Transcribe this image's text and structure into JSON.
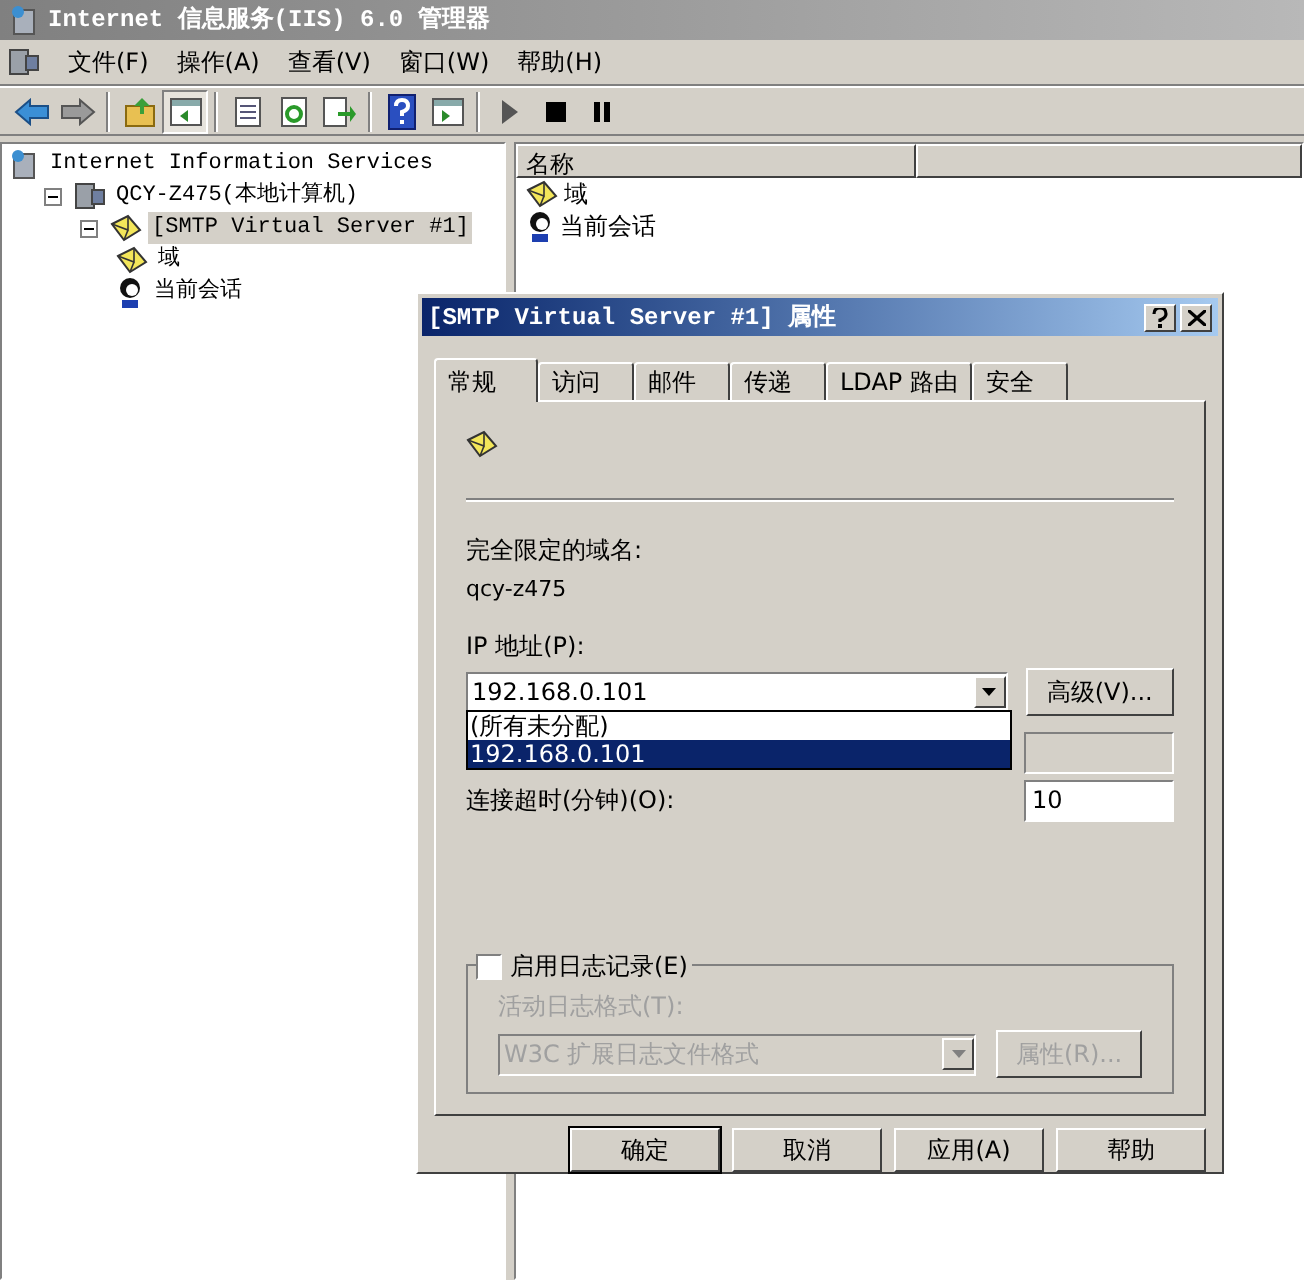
{
  "window": {
    "title": "Internet 信息服务(IIS) 6.0 管理器"
  },
  "menu": [
    "文件(F)",
    "操作(A)",
    "查看(V)",
    "窗口(W)",
    "帮助(H)"
  ],
  "toolbar": [
    {
      "kind": "back"
    },
    {
      "kind": "forward"
    },
    {
      "kind": "sep"
    },
    {
      "kind": "up"
    },
    {
      "kind": "tree",
      "selected": true
    },
    {
      "kind": "sep"
    },
    {
      "kind": "props"
    },
    {
      "kind": "refresh"
    },
    {
      "kind": "export"
    },
    {
      "kind": "sep"
    },
    {
      "kind": "help"
    },
    {
      "kind": "panel"
    },
    {
      "kind": "sep"
    },
    {
      "kind": "play"
    },
    {
      "kind": "stop"
    },
    {
      "kind": "pause"
    }
  ],
  "tree": [
    {
      "label": "Internet Information Services",
      "kind": "iis",
      "children": [
        {
          "label": "QCY-Z475(本地计算机)",
          "kind": "computer",
          "expanded": true,
          "children": [
            {
              "label": "[SMTP Virtual Server #1]",
              "kind": "smtp",
              "expanded": true,
              "selected": true,
              "children": [
                {
                  "label": "域",
                  "kind": "domain",
                  "selected": false
                },
                {
                  "label": "当前会话",
                  "kind": "session",
                  "selected": false
                }
              ]
            }
          ]
        }
      ]
    }
  ],
  "list": {
    "columns": [
      "名称"
    ],
    "rows": [
      {
        "label": "域",
        "kind": "domain"
      },
      {
        "label": "当前会话",
        "kind": "session"
      }
    ]
  },
  "dialog": {
    "title": "[SMTP Virtual Server #1] 属性",
    "tabs": [
      {
        "label": "常规",
        "selected": true
      },
      {
        "label": "访问",
        "selected": false
      },
      {
        "label": "邮件",
        "selected": false
      },
      {
        "label": "传递",
        "selected": false
      },
      {
        "label": "LDAP 路由",
        "selected": false
      },
      {
        "label": "安全",
        "selected": false
      }
    ],
    "fqdn_label": "完全限定的域名:",
    "fqdn_value": "qcy-z475",
    "ip_label": "IP 地址(P):",
    "ip_value": "192.168.0.101",
    "ip_options": [
      {
        "label": "(所有未分配)",
        "selected": false
      },
      {
        "label": "192.168.0.101",
        "selected": true
      }
    ],
    "advanced_button": "高级(V)...",
    "timeout_label": "连接超时(分钟)(O):",
    "timeout_value": "10",
    "logging": {
      "label": "启用日志记录(E)",
      "checked": false,
      "format_label": "活动日志格式(T):",
      "format_value": "W3C 扩展日志文件格式",
      "properties_button": "属性(R)..."
    },
    "buttons": [
      "确定",
      "取消",
      "应用(A)",
      "帮助"
    ]
  }
}
